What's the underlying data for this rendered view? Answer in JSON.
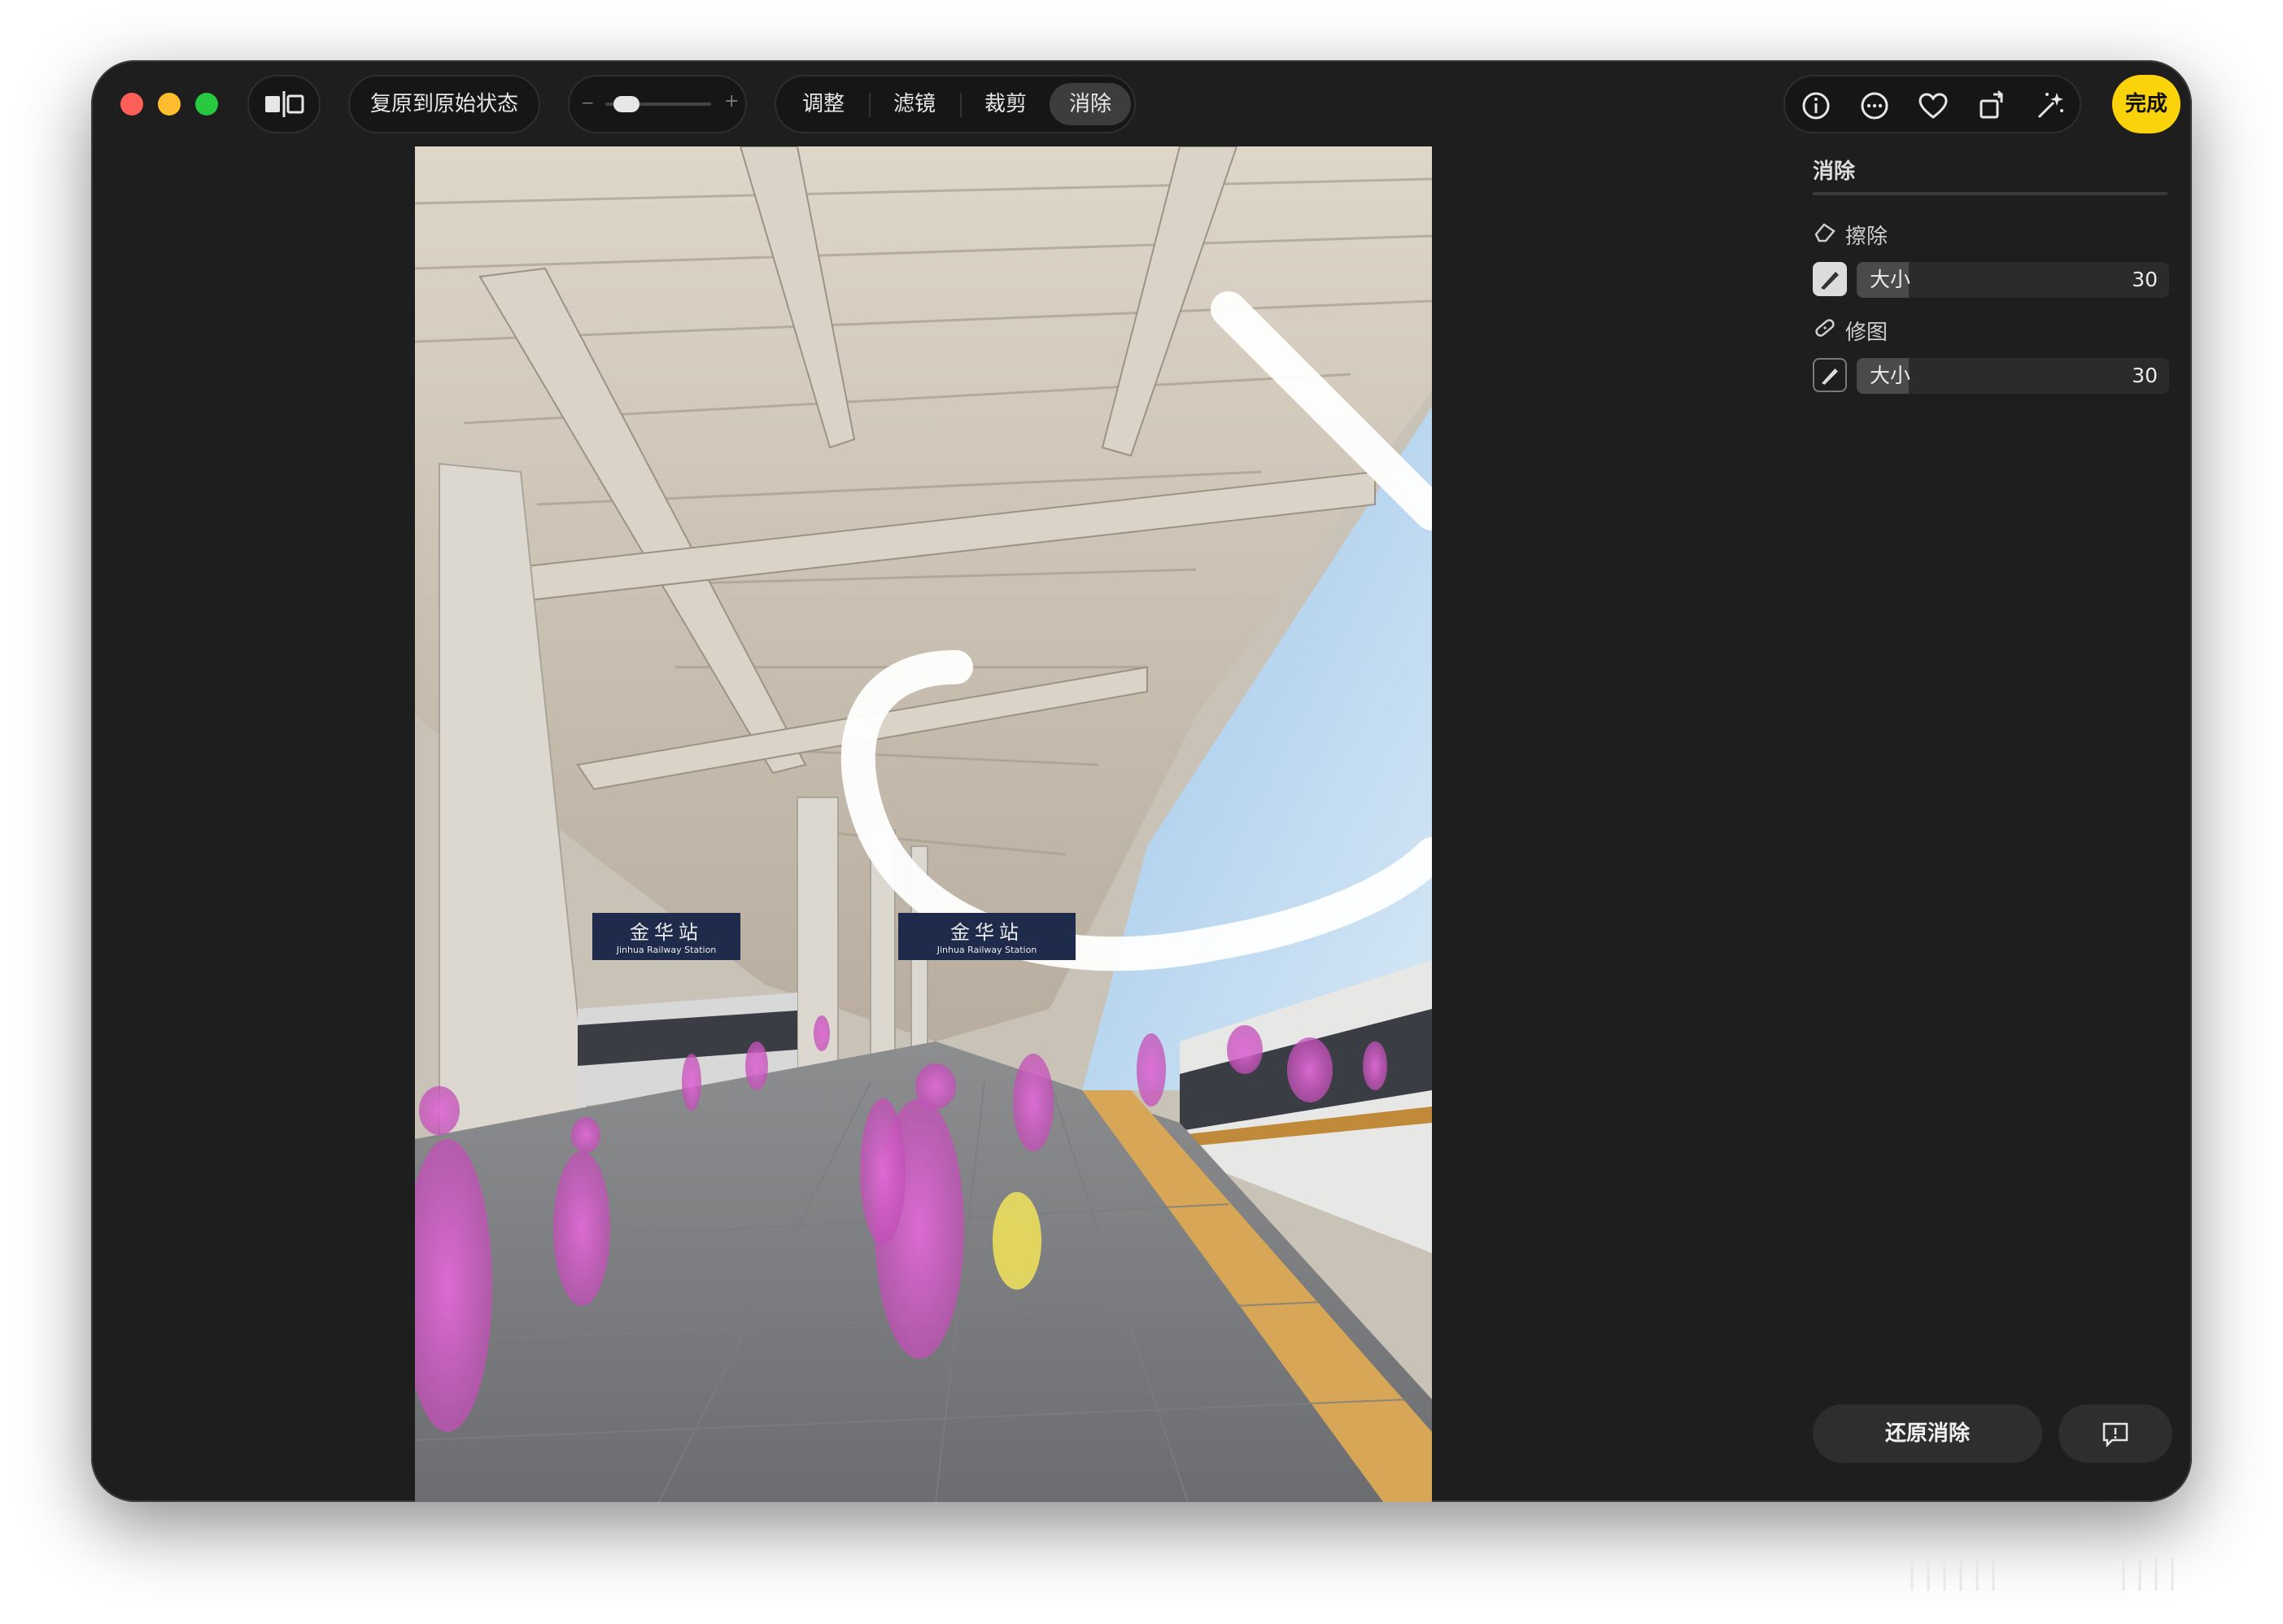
{
  "window": {
    "traffic_lights": {
      "close": "#ff5f57",
      "minimize": "#febc2e",
      "zoom": "#28c840"
    }
  },
  "toolbar": {
    "revert_label": "复原到原始状态",
    "zoom_slider": {
      "value": 0.1
    },
    "tabs": [
      {
        "label": "调整",
        "active": false
      },
      {
        "label": "滤镜",
        "active": false
      },
      {
        "label": "裁剪",
        "active": false
      },
      {
        "label": "消除",
        "active": true
      }
    ],
    "right_icons": [
      "info-icon",
      "more-icon",
      "heart-icon",
      "rotate-icon",
      "magic-wand-icon"
    ],
    "done_label": "完成",
    "accent": "#fbd30b"
  },
  "photo": {
    "signs": [
      {
        "cn": "金华站",
        "en": "Jinhua Railway Station"
      },
      {
        "cn": "金华站",
        "en": "Jinhua Railway Station"
      }
    ]
  },
  "panel": {
    "title": "消除",
    "erase": {
      "label": "擦除",
      "size_label": "大小",
      "size_value": "30",
      "fill": 0.3
    },
    "retouch": {
      "label": "修图",
      "size_label": "大小",
      "size_value": "30",
      "fill": 0.3
    },
    "restore_label": "还原消除",
    "feedback_icon": "feedback-icon"
  }
}
